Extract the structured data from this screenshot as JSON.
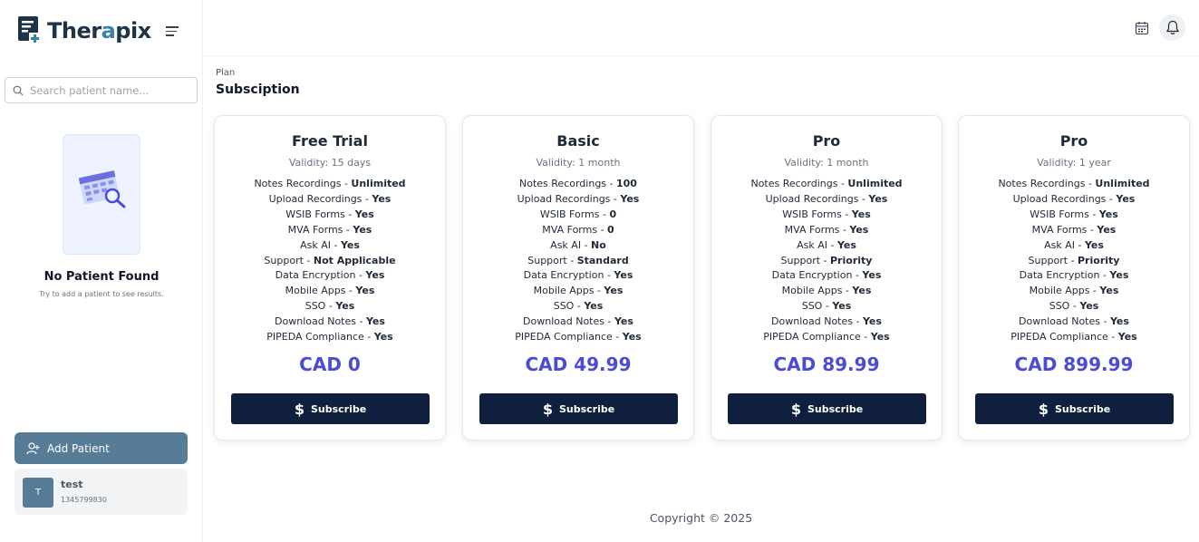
{
  "brand": {
    "name_main": "Ther",
    "name_accent": "a",
    "name_end": "pix"
  },
  "sidebar": {
    "search_placeholder": "Search patient name...",
    "empty_title": "No Patient Found",
    "empty_subtitle": "Try to add a patient to see results.",
    "add_patient_label": "Add Patient",
    "patients": [
      {
        "initial": "T",
        "name": "test",
        "phone": "1345799830"
      }
    ]
  },
  "header": {
    "breadcrumb": "Plan",
    "title": "Subsciption"
  },
  "plans": [
    {
      "name": "Free Trial",
      "validity": "Validity: 15 days",
      "features": [
        {
          "label": "Notes Recordings",
          "value": "Unlimited"
        },
        {
          "label": "Upload Recordings",
          "value": "Yes"
        },
        {
          "label": "WSIB Forms",
          "value": "Yes"
        },
        {
          "label": "MVA Forms",
          "value": "Yes"
        },
        {
          "label": "Ask AI",
          "value": "Yes"
        },
        {
          "label": "Support",
          "value": "Not Applicable"
        },
        {
          "label": "Data Encryption",
          "value": "Yes"
        },
        {
          "label": "Mobile Apps",
          "value": "Yes"
        },
        {
          "label": "SSO",
          "value": "Yes"
        },
        {
          "label": "Download Notes",
          "value": "Yes"
        },
        {
          "label": "PIPEDA Compliance",
          "value": "Yes"
        }
      ],
      "price": "CAD 0",
      "button": "Subscribe"
    },
    {
      "name": "Basic",
      "validity": "Validity: 1 month",
      "features": [
        {
          "label": "Notes Recordings",
          "value": "100"
        },
        {
          "label": "Upload Recordings",
          "value": "Yes"
        },
        {
          "label": "WSIB Forms",
          "value": "0"
        },
        {
          "label": "MVA Forms",
          "value": "0"
        },
        {
          "label": "Ask AI",
          "value": "No"
        },
        {
          "label": "Support",
          "value": "Standard"
        },
        {
          "label": "Data Encryption",
          "value": "Yes"
        },
        {
          "label": "Mobile Apps",
          "value": "Yes"
        },
        {
          "label": "SSO",
          "value": "Yes"
        },
        {
          "label": "Download Notes",
          "value": "Yes"
        },
        {
          "label": "PIPEDA Compliance",
          "value": "Yes"
        }
      ],
      "price": "CAD 49.99",
      "button": "Subscribe"
    },
    {
      "name": "Pro",
      "validity": "Validity: 1 month",
      "features": [
        {
          "label": "Notes Recordings",
          "value": "Unlimited"
        },
        {
          "label": "Upload Recordings",
          "value": "Yes"
        },
        {
          "label": "WSIB Forms",
          "value": "Yes"
        },
        {
          "label": "MVA Forms",
          "value": "Yes"
        },
        {
          "label": "Ask AI",
          "value": "Yes"
        },
        {
          "label": "Support",
          "value": "Priority"
        },
        {
          "label": "Data Encryption",
          "value": "Yes"
        },
        {
          "label": "Mobile Apps",
          "value": "Yes"
        },
        {
          "label": "SSO",
          "value": "Yes"
        },
        {
          "label": "Download Notes",
          "value": "Yes"
        },
        {
          "label": "PIPEDA Compliance",
          "value": "Yes"
        }
      ],
      "price": "CAD 89.99",
      "button": "Subscribe"
    },
    {
      "name": "Pro",
      "validity": "Validity: 1 year",
      "features": [
        {
          "label": "Notes Recordings",
          "value": "Unlimited"
        },
        {
          "label": "Upload Recordings",
          "value": "Yes"
        },
        {
          "label": "WSIB Forms",
          "value": "Yes"
        },
        {
          "label": "MVA Forms",
          "value": "Yes"
        },
        {
          "label": "Ask AI",
          "value": "Yes"
        },
        {
          "label": "Support",
          "value": "Priority"
        },
        {
          "label": "Data Encryption",
          "value": "Yes"
        },
        {
          "label": "Mobile Apps",
          "value": "Yes"
        },
        {
          "label": "SSO",
          "value": "Yes"
        },
        {
          "label": "Download Notes",
          "value": "Yes"
        },
        {
          "label": "PIPEDA Compliance",
          "value": "Yes"
        }
      ],
      "price": "CAD 899.99",
      "button": "Subscribe"
    }
  ],
  "footer": {
    "copyright": "Copyright © 2025"
  },
  "colors": {
    "brand_dark": "#1e3346",
    "accent": "#4b4bd6",
    "button_dark": "#0f1f3d",
    "sidebar_button": "#577c97"
  },
  "icons": [
    "logo-icon",
    "menu-icon",
    "search-icon",
    "empty-calendar-search-icon",
    "user-plus-icon",
    "calendar-icon",
    "bell-icon",
    "dollar-icon"
  ]
}
